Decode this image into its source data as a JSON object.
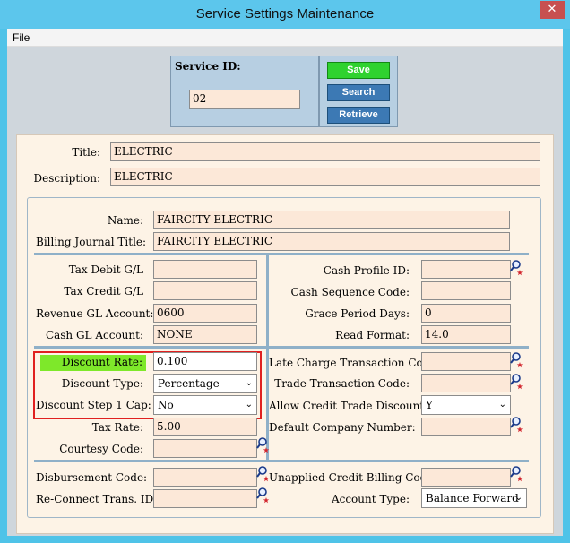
{
  "window": {
    "title": "Service Settings Maintenance",
    "close_glyph": "✕"
  },
  "menu": {
    "file": "File"
  },
  "service": {
    "id_label": "Service ID:",
    "id_value": "02"
  },
  "actions": {
    "save": "Save",
    "search": "Search",
    "retrieve": "Retrieve"
  },
  "header": {
    "title_label": "Title:",
    "title_value": "ELECTRIC",
    "description_label": "Description:",
    "description_value": "ELECTRIC"
  },
  "names": {
    "name_label": "Name:",
    "name_value": "FAIRCITY ELECTRIC",
    "billing_journal_label": "Billing Journal Title:",
    "billing_journal_value": "FAIRCITY ELECTRIC"
  },
  "accounts": {
    "tax_debit_label": "Tax Debit G/L",
    "tax_debit_value": "",
    "tax_credit_label": "Tax Credit G/L",
    "tax_credit_value": "",
    "revenue_label": "Revenue GL Account:",
    "revenue_value": "0600",
    "cash_gl_label": "Cash GL Account:",
    "cash_gl_value": "NONE",
    "cash_profile_label": "Cash Profile ID:",
    "cash_profile_value": "",
    "cash_sequence_label": "Cash Sequence Code:",
    "cash_sequence_value": "",
    "grace_period_label": "Grace Period Days:",
    "grace_period_value": "0",
    "read_format_label": "Read Format:",
    "read_format_value": "14.0"
  },
  "discount": {
    "rate_label": "Discount Rate:",
    "rate_value": "0.100",
    "type_label": "Discount Type:",
    "type_value": "Percentage",
    "step_cap_label": "Discount Step 1 Cap:",
    "step_cap_value": "No",
    "tax_rate_label": "Tax Rate:",
    "tax_rate_value": "5.00",
    "courtesy_label": "Courtesy Code:",
    "courtesy_value": "",
    "late_charge_label": "Late Charge Transaction Code:",
    "late_charge_value": "",
    "trade_label": "Trade Transaction Code:",
    "trade_value": "",
    "allow_credit_label": "Allow Credit Trade Discounts:",
    "allow_credit_value": "Y",
    "default_company_label": "Default Company Number:",
    "default_company_value": ""
  },
  "footer": {
    "disbursement_label": "Disbursement Code:",
    "disbursement_value": "",
    "reconnect_label": "Re-Connect Trans. ID:",
    "reconnect_value": "",
    "unapplied_label": "Unapplied Credit Billing Code:",
    "unapplied_value": "",
    "account_type_label": "Account Type:",
    "account_type_value": "Balance Forward"
  },
  "colors": {
    "accent": "#5cc6ec",
    "field_bg": "#fce8d8",
    "highlight": "#e02020",
    "save": "#2fd22f",
    "button": "#3c79b4"
  }
}
